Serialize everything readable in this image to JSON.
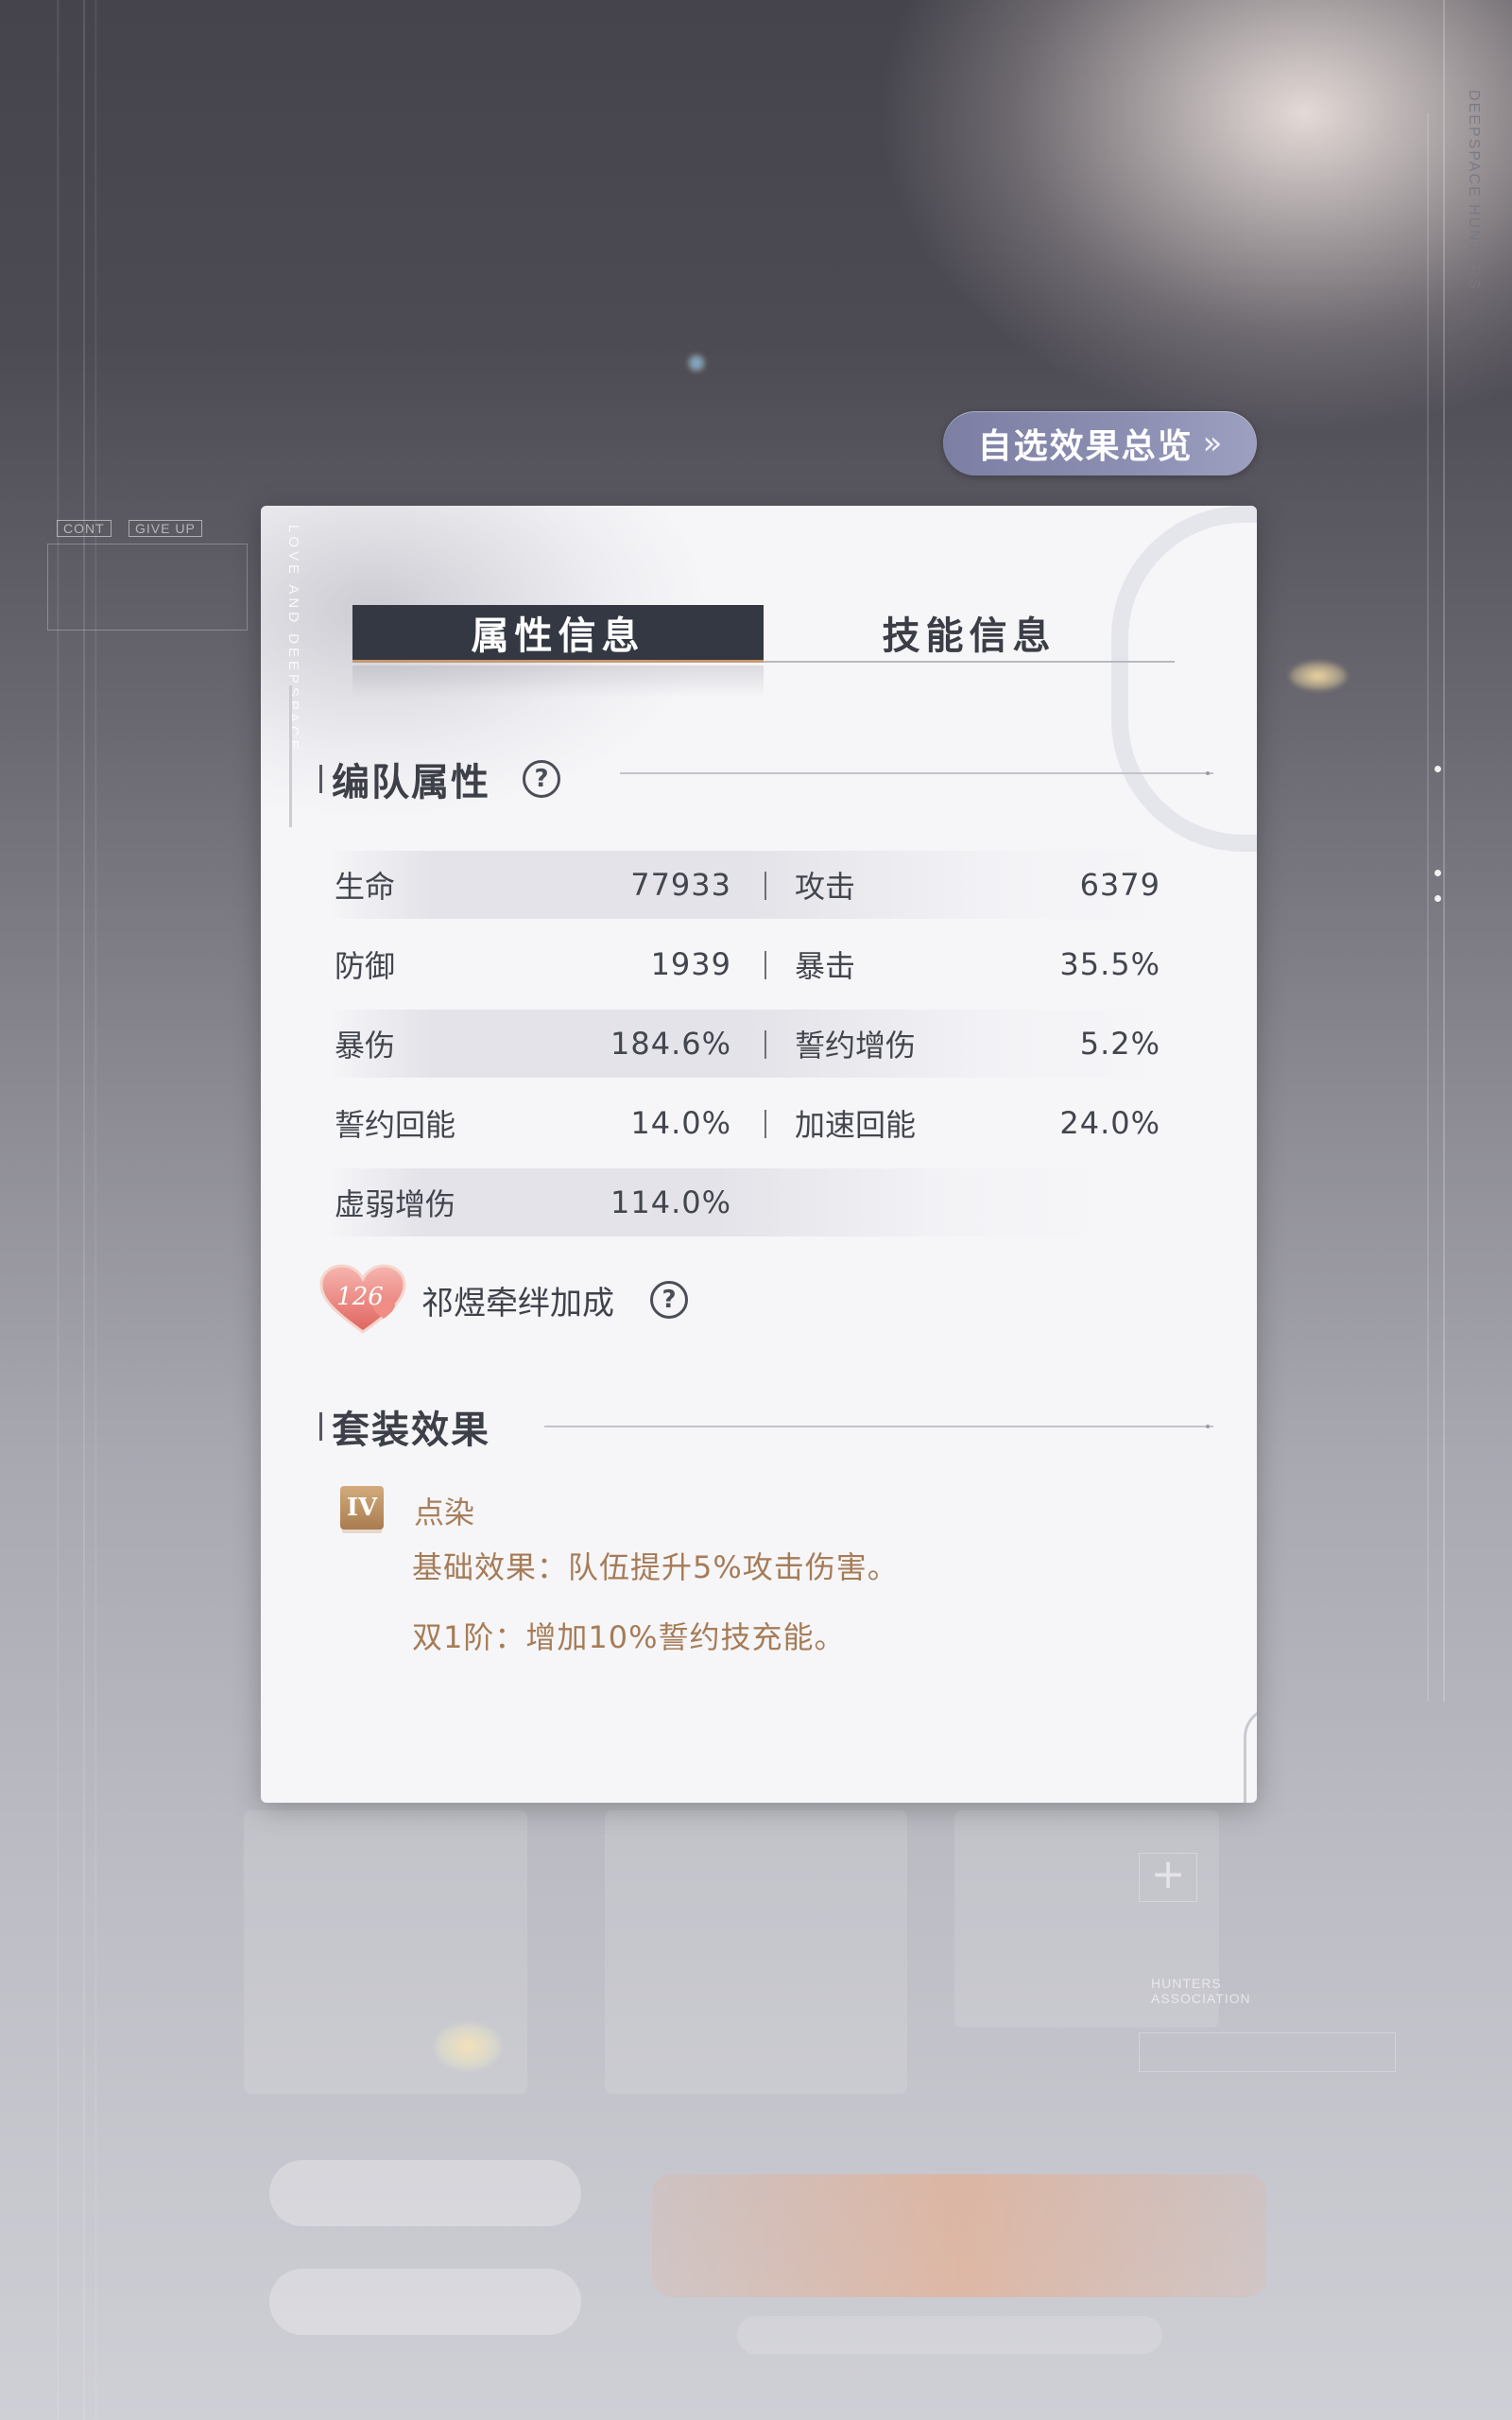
{
  "header": {
    "overview_button_label": "自选效果总览",
    "overview_chevron": "»"
  },
  "background": {
    "vertical_brand": "DEEPSPACE HUNTERS",
    "small_tags": [
      "CONT",
      "GIVE UP"
    ],
    "association_label": "HUNTERS ASSOCIATION",
    "plus_symbol": "+"
  },
  "panel": {
    "vertical_text": "LOVE AND DEEPSPACE",
    "tabs": [
      {
        "label": "属性信息",
        "active": true
      },
      {
        "label": "技能信息",
        "active": false
      }
    ],
    "team_section": {
      "title": "编队属性",
      "help_symbol": "?"
    },
    "stats": [
      {
        "left_label": "生命",
        "left_value": "77933",
        "right_label": "攻击",
        "right_value": "6379"
      },
      {
        "left_label": "防御",
        "left_value": "1939",
        "right_label": "暴击",
        "right_value": "35.5%"
      },
      {
        "left_label": "暴伤",
        "left_value": "184.6%",
        "right_label": "誓约增伤",
        "right_value": "5.2%"
      },
      {
        "left_label": "誓约回能",
        "left_value": "14.0%",
        "right_label": "加速回能",
        "right_value": "24.0%"
      },
      {
        "left_label": "虚弱增伤",
        "left_value": "114.0%"
      }
    ],
    "bond": {
      "level": "126",
      "label": "祁煜牵绊加成",
      "help_symbol": "?"
    },
    "set_section": {
      "title": "套装效果",
      "badge": "IV",
      "set_name": "点染",
      "lines": [
        "基础效果：队伍提升5%攻击伤害。",
        "双1阶：增加10%誓约技充能。"
      ]
    }
  },
  "colors": {
    "tab_active_bg": "#333842",
    "tab_underline": "#c69870",
    "accent_gold": "#a67c57",
    "overview_pill": "#8c8fb2"
  }
}
